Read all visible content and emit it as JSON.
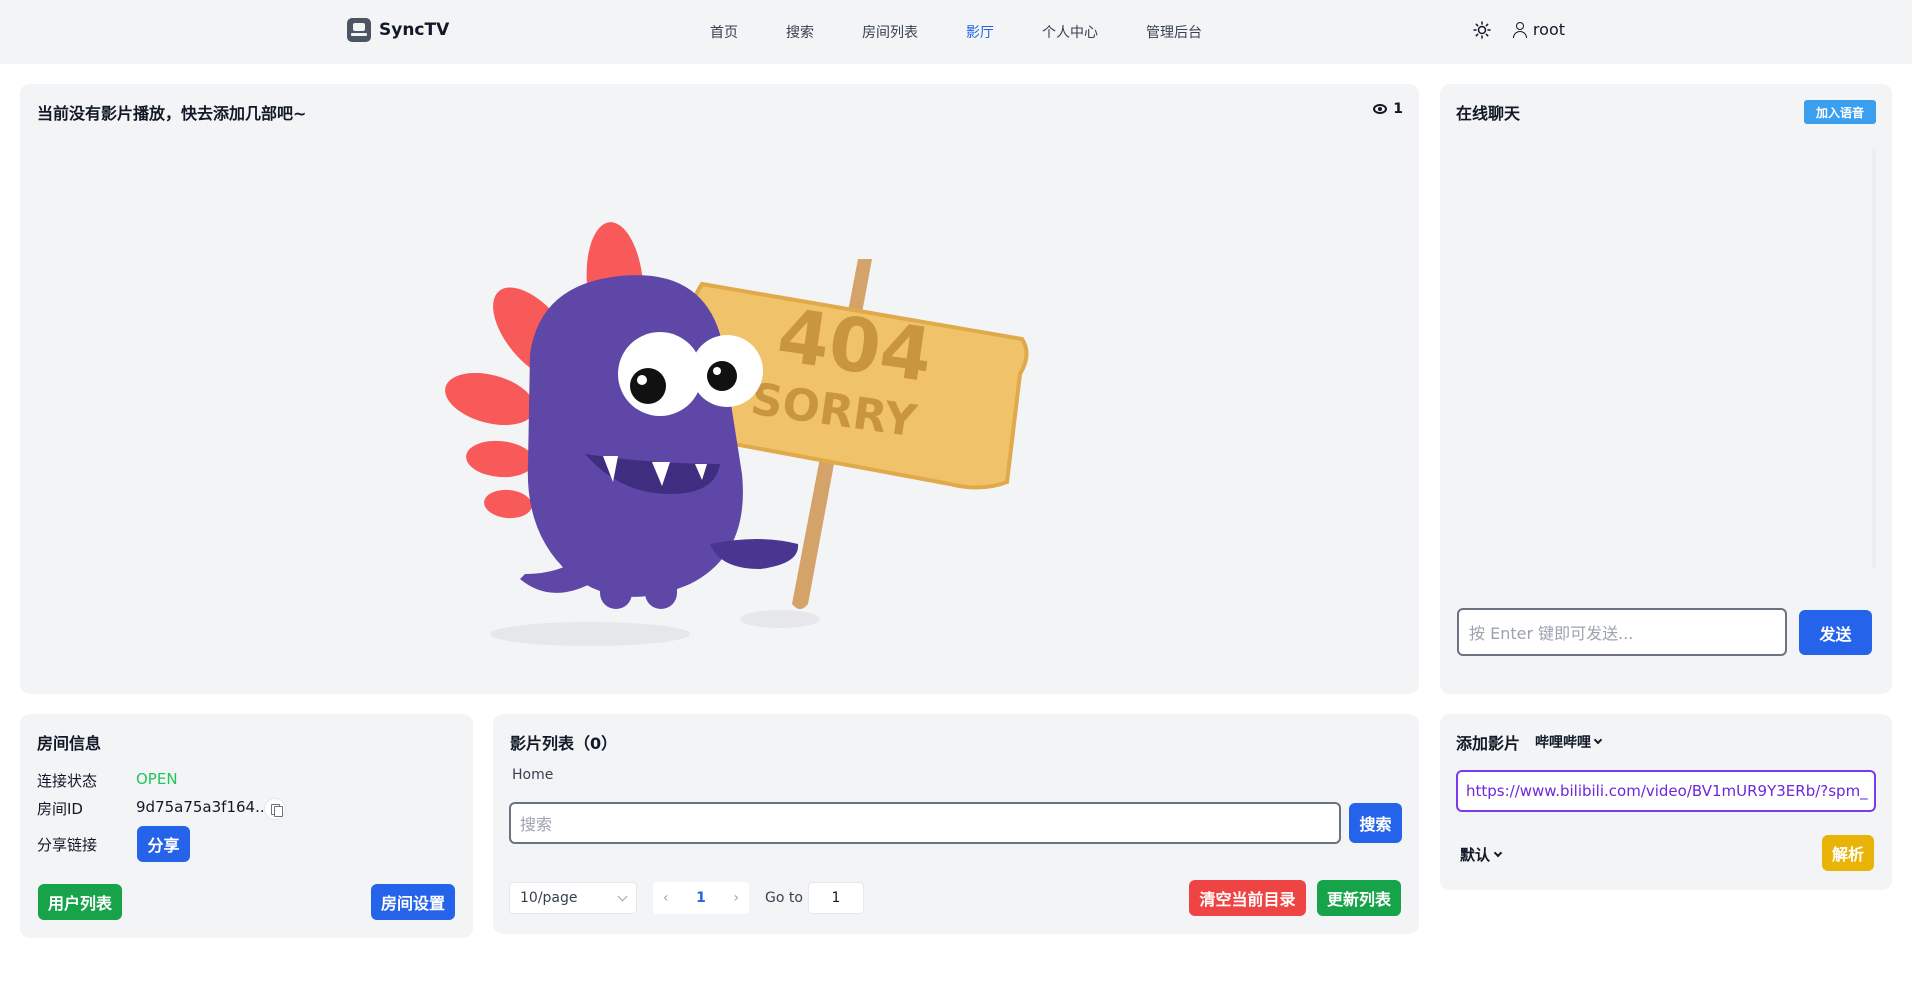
{
  "header": {
    "app_name": "SyncTV",
    "nav": [
      "首页",
      "搜索",
      "房间列表",
      "影厅",
      "个人中心",
      "管理后台"
    ],
    "active_nav": "影厅",
    "username": "root"
  },
  "player": {
    "title": "当前没有影片播放，快去添加几部吧~",
    "viewer_count": "1",
    "illustration": {
      "sign_line1": "404",
      "sign_line2": "SORRY"
    }
  },
  "chat": {
    "title": "在线聊天",
    "voice_button": "加入语音",
    "input_placeholder": "按 Enter 键即可发送...",
    "send_button": "发送"
  },
  "room_info": {
    "title": "房间信息",
    "status_label": "连接状态",
    "status_value": "OPEN",
    "room_id_label": "房间ID",
    "room_id_value": "9d75a75a3f164...",
    "share_label": "分享链接",
    "share_button": "分享",
    "user_list_button": "用户列表",
    "room_settings_button": "房间设置"
  },
  "movie_list": {
    "title": "影片列表（0）",
    "breadcrumb": "Home",
    "search_placeholder": "搜索",
    "search_button": "搜索",
    "page_size": "10/page",
    "prev_arrow": "‹",
    "current_page": "1",
    "next_arrow": "›",
    "goto_label": "Go to",
    "goto_value": "1",
    "clear_button": "清空当前目录",
    "refresh_button": "更新列表"
  },
  "add_movie": {
    "title": "添加影片",
    "source": "哔哩哔哩",
    "url_value": "https://www.bilibili.com/video/BV1mUR9Y3ERb/?spm_",
    "mode": "默认",
    "parse_button": "解析"
  },
  "colors": {
    "primary": "#2563eb",
    "success": "#16a34a",
    "danger": "#ef4444",
    "warning": "#eab308",
    "card_bg": "#f3f4f6",
    "monster": "#5e47a6",
    "sign": "#f0c36b"
  }
}
